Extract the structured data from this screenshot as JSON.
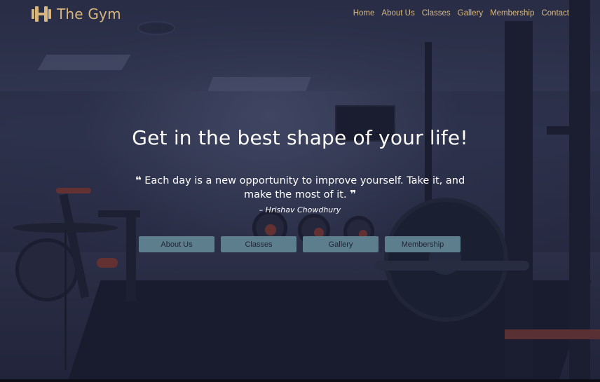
{
  "brand": {
    "name": "The Gym",
    "icon": "dumbbell-icon",
    "color": "#d8b77e"
  },
  "nav": {
    "items": [
      "Home",
      "About Us",
      "Classes",
      "Gallery",
      "Membership",
      "Contact"
    ]
  },
  "hero": {
    "title": "Get in the best shape of your life!",
    "quote_open": "❝",
    "quote_text": "Each day is a new opportunity to improve yourself. Take it, and make the most of it.",
    "quote_close": "❞",
    "author": "– Hrishav Chowdhury"
  },
  "buttons": [
    "About Us",
    "Classes",
    "Gallery",
    "Membership"
  ],
  "colors": {
    "accent": "#d8b77e",
    "button_bg": "#5d7e8d",
    "button_text": "#1c2336",
    "text": "#ffffff"
  }
}
